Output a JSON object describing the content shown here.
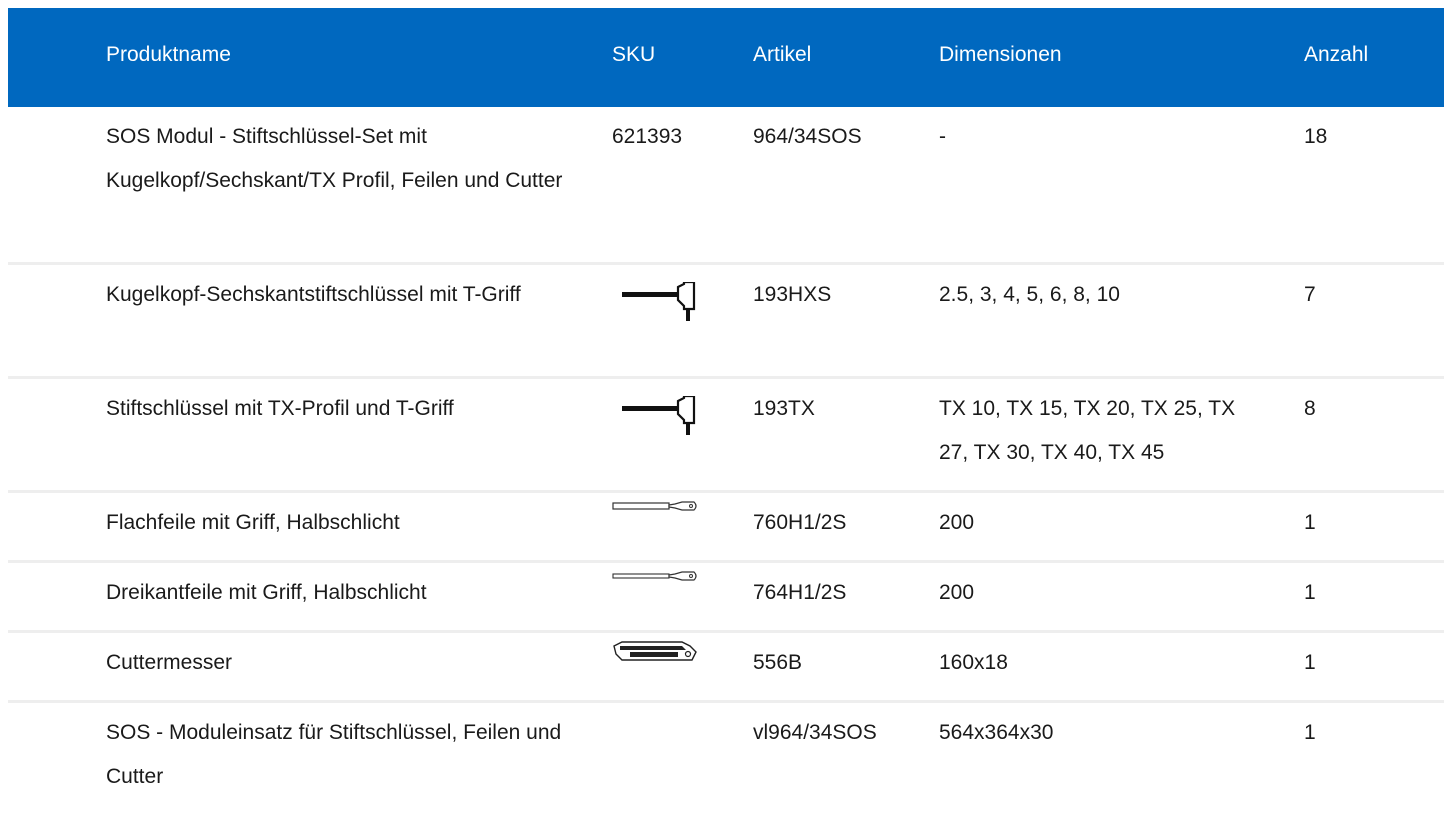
{
  "header": {
    "name": "Produktname",
    "sku": "SKU",
    "article": "Artikel",
    "dimensions": "Dimensionen",
    "quantity": "Anzahl"
  },
  "rows": [
    {
      "name": "SOS Modul - Stiftschlüssel-Set mit Kugelkopf/Sechskant/TX Profil, Feilen und Cutter",
      "sku": "621393",
      "icon": "",
      "article": "964/34SOS",
      "dimensions": "-",
      "quantity": "18"
    },
    {
      "name": "Kugelkopf-Sechskantstiftschlüssel mit T-Griff",
      "sku": "",
      "icon": "t-handle-hex-key-icon",
      "article": "193HXS",
      "dimensions": "2.5, 3, 4, 5, 6, 8, 10",
      "quantity": "7"
    },
    {
      "name": "Stiftschlüssel mit TX-Profil und T-Griff",
      "sku": "",
      "icon": "t-handle-torx-key-icon",
      "article": "193TX",
      "dimensions": "TX 10, TX 15, TX 20, TX 25, TX 27, TX 30, TX 40, TX 45",
      "quantity": "8"
    },
    {
      "name": "Flachfeile mit Griff, Halbschlicht",
      "sku": "",
      "icon": "flat-file-icon",
      "article": "760H1/2S",
      "dimensions": "200",
      "quantity": "1"
    },
    {
      "name": "Dreikantfeile mit Griff, Halbschlicht",
      "sku": "",
      "icon": "triangular-file-icon",
      "article": "764H1/2S",
      "dimensions": "200",
      "quantity": "1"
    },
    {
      "name": "Cuttermesser",
      "sku": "",
      "icon": "cutter-knife-icon",
      "article": "556B",
      "dimensions": "160x18",
      "quantity": "1"
    },
    {
      "name": "SOS - Moduleinsatz für Stiftschlüssel, Feilen und Cutter",
      "sku": "",
      "icon": "",
      "article": "vl964/34SOS",
      "dimensions": "564x364x30",
      "quantity": "1"
    }
  ]
}
